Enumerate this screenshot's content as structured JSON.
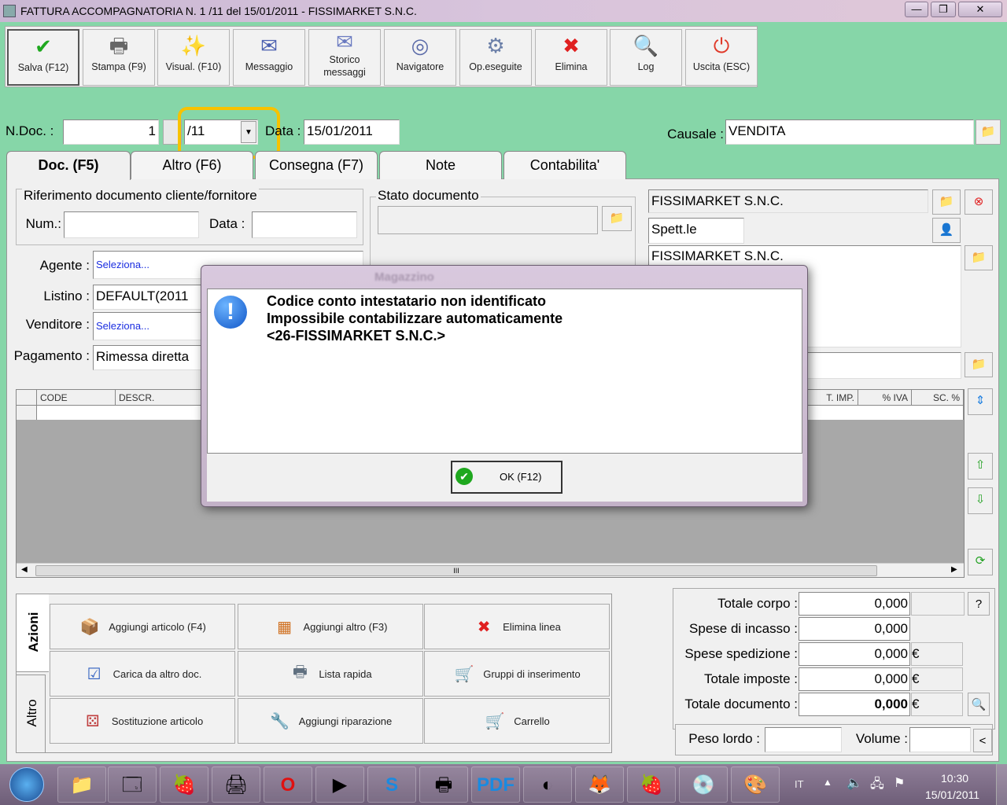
{
  "window": {
    "title": "FATTURA ACCOMPAGNATORIA N. 1 /11 del 15/01/2011 - FISSIMARKET S.N.C.",
    "minimize": "—",
    "maximize": "❐",
    "close": "✕"
  },
  "toolbar": [
    {
      "label": "Salva (F12)",
      "icon": "check-icon",
      "glyph": "✔",
      "color": "#1fa81f"
    },
    {
      "label": "Stampa (F9)",
      "icon": "printer-icon",
      "glyph": "🖶",
      "color": "#666"
    },
    {
      "label": "Visual. (F10)",
      "icon": "magic-wand-icon",
      "glyph": "✨",
      "color": "#d4a400"
    },
    {
      "label": "Messaggio",
      "icon": "envelope-pen-icon",
      "glyph": "✉",
      "color": "#4a5fb0"
    },
    {
      "label": "Storico\nmessaggi",
      "icon": "envelope-search-icon",
      "glyph": "✉",
      "color": "#6a7ac0"
    },
    {
      "label": "Navigatore",
      "icon": "compass-icon",
      "glyph": "◎",
      "color": "#5a6aa8"
    },
    {
      "label": "Op.eseguite",
      "icon": "gears-search-icon",
      "glyph": "⚙",
      "color": "#6b7fa8"
    },
    {
      "label": "Elimina",
      "icon": "red-x-icon",
      "glyph": "✖",
      "color": "#e02020"
    },
    {
      "label": "Log",
      "icon": "log-search-icon",
      "glyph": "🔍",
      "color": "#2060c0"
    },
    {
      "label": "Uscita (ESC)",
      "icon": "exit-icon",
      "glyph": "⏻",
      "color": "#e03a2a"
    }
  ],
  "header": {
    "ndoc_label": "N.Doc. :",
    "ndoc_value": "1",
    "series_value": "/11",
    "date_label": "Data :",
    "date_value": "15/01/2011",
    "causale_label": "Causale :",
    "causale_value": "VENDITA"
  },
  "tabs": [
    "Doc. (F5)",
    "Altro (F6)",
    "Consegna (F7)",
    "Note",
    "Contabilita'"
  ],
  "doc": {
    "rif_legend": "Riferimento documento cliente/fornitore",
    "num_label": "Num.:",
    "data_label": "Data :",
    "stato_legend": "Stato documento",
    "agente_label": "Agente :",
    "agente_value": "Seleziona...",
    "listino_label": "Listino :",
    "listino_value": "DEFAULT(2011",
    "venditore_label": "Venditore :",
    "venditore_value": "Seleziona...",
    "pagamento_label": "Pagamento :",
    "pagamento_value": "Rimessa diretta",
    "cliente_name": "FISSIMARKET S.N.C.",
    "title_value": "Spett.le",
    "address_first": "FISSIMARKET S.N.C."
  },
  "grid": {
    "columns_left": [
      "CODE",
      "DESCR."
    ],
    "columns_right": [
      "T. IMP.",
      "% IVA",
      "SC. %"
    ],
    "hscroll_grip": "III"
  },
  "actions": {
    "tab_azioni": "Azioni",
    "tab_altro": "Altro",
    "buttons": [
      {
        "label": "Aggiungi articolo (F4)",
        "glyph": "📦"
      },
      {
        "label": "Aggiungi altro (F3)",
        "glyph": "▦"
      },
      {
        "label": "Elimina linea",
        "glyph": "✖"
      },
      {
        "label": "Carica da altro doc.",
        "glyph": "☑"
      },
      {
        "label": "Lista rapida",
        "glyph": "🖶"
      },
      {
        "label": "Gruppi di inserimento",
        "glyph": "🛒"
      },
      {
        "label": "Sostituzione articolo",
        "glyph": "⚄"
      },
      {
        "label": "Aggiungi riparazione",
        "glyph": "🔧"
      },
      {
        "label": "Carrello",
        "glyph": "🛒"
      }
    ]
  },
  "totals": {
    "rows": [
      {
        "label": "Totale corpo :",
        "value": "0,000",
        "cur": ""
      },
      {
        "label": "Spese di incasso :",
        "value": "0,000",
        "cur": ""
      },
      {
        "label": "Spese spedizione :",
        "value": "0,000",
        "cur": "€"
      },
      {
        "label": "Totale imposte :",
        "value": "0,000",
        "cur": "€"
      },
      {
        "label": "Totale documento :",
        "value": "0,000",
        "cur": "€"
      }
    ],
    "help_btn": "?",
    "peso_label": "Peso lordo :",
    "volume_label": "Volume :",
    "collapse_btn": "<"
  },
  "dialog": {
    "title": "Magazzino",
    "line1": "Codice conto intestatario non identificato",
    "line2": "Impossibile contabilizzare automaticamente",
    "line3": "<26-FISSIMARKET S.N.C.>",
    "ok_label": "OK (F12)"
  },
  "taskbar": {
    "lang": "IT",
    "time": "10:30",
    "date": "15/01/2011",
    "apps": [
      "📁",
      "🗔",
      "🍓",
      "🖨",
      "O",
      "▶",
      "S",
      "🖶",
      "PDF",
      "◐",
      "🦊",
      "🍓",
      "💿",
      "🎨"
    ]
  }
}
